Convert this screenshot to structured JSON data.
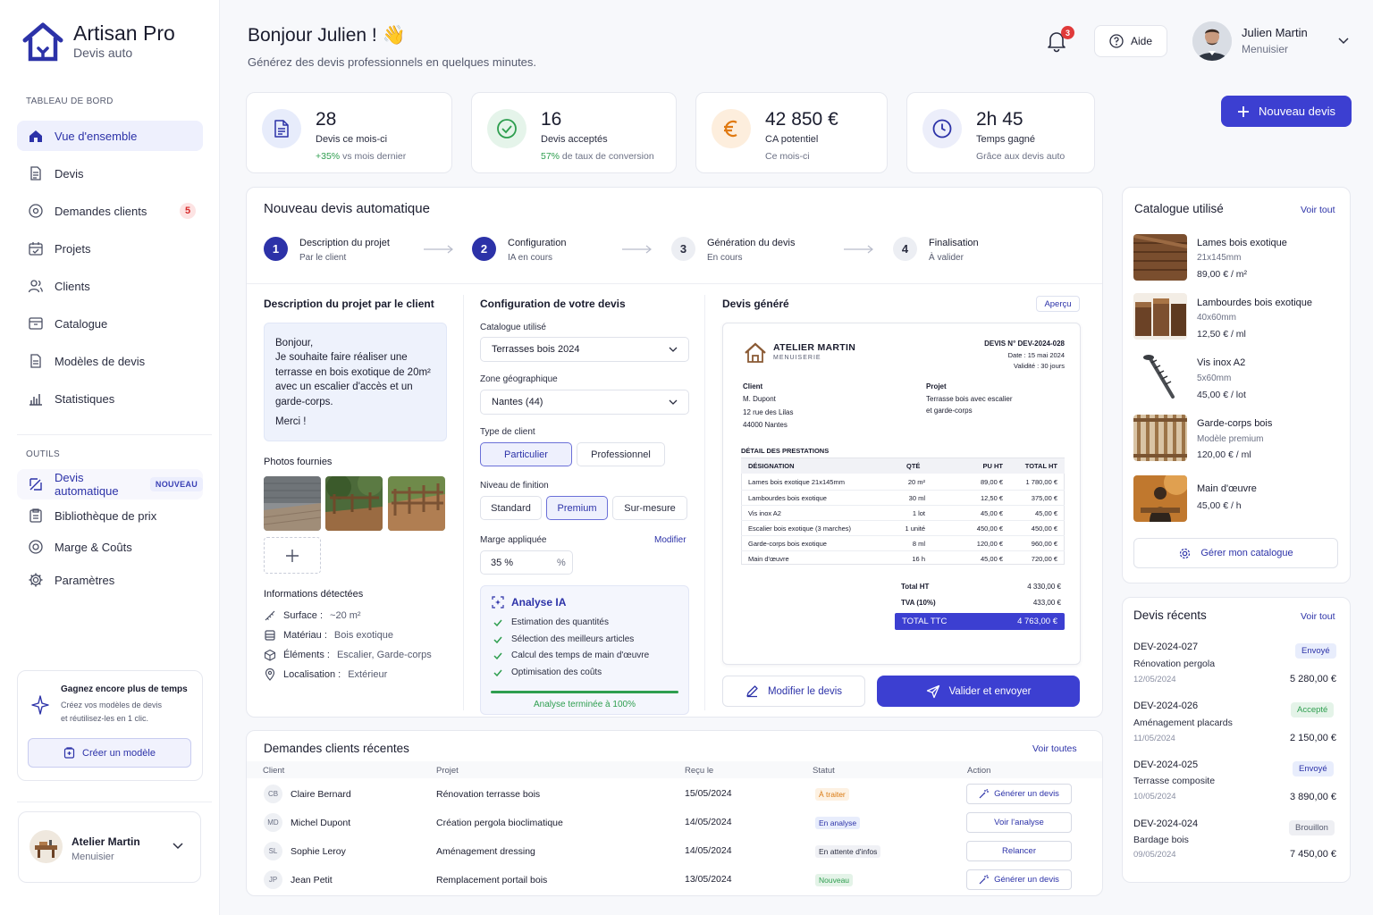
{
  "brand": {
    "title": "Artisan Pro",
    "subtitle": "Devis auto"
  },
  "sidebar": {
    "section_dashboard": "TABLEAU DE BORD",
    "items": [
      {
        "label": "Vue d'ensemble"
      },
      {
        "label": "Devis"
      },
      {
        "label": "Demandes clients",
        "badge": "5"
      },
      {
        "label": "Projets"
      },
      {
        "label": "Clients"
      },
      {
        "label": "Catalogue"
      },
      {
        "label": "Modèles de devis"
      },
      {
        "label": "Statistiques"
      }
    ],
    "section_tools": "OUTILS",
    "tools": [
      {
        "label": "Devis automatique",
        "badge": "NOUVEAU"
      },
      {
        "label": "Bibliothèque de prix"
      },
      {
        "label": "Marge & Coûts"
      },
      {
        "label": "Paramètres"
      }
    ],
    "tip": {
      "title": "Gagnez encore plus de temps",
      "text1": "Créez vos modèles de devis",
      "text2": "et réutilisez-les en 1 clic.",
      "button": "Créer un modèle"
    },
    "company": {
      "name": "Atelier Martin",
      "role": "Menuisier"
    }
  },
  "header": {
    "greeting": "Bonjour Julien ! 👋",
    "subtitle": "Générez des devis professionnels en quelques minutes.",
    "notifications": "3",
    "help": "Aide",
    "user": {
      "name": "Julien Martin",
      "role": "Menuisier"
    }
  },
  "stats": [
    {
      "value": "28",
      "label": "Devis ce mois-ci",
      "highlight": "+35%",
      "sub": " vs mois dernier"
    },
    {
      "value": "16",
      "label": "Devis acceptés",
      "highlight": "57%",
      "sub": " de taux de conversion"
    },
    {
      "value": "42 850 €",
      "label": "CA potentiel",
      "highlight": "",
      "sub": "Ce mois-ci"
    },
    {
      "value": "2h 45",
      "label": "Temps gagné",
      "highlight": "",
      "sub": "Grâce aux devis auto"
    }
  ],
  "new_quote_button": "Nouveau devis",
  "wizard": {
    "title": "Nouveau devis automatique",
    "steps": [
      {
        "n": "1",
        "title": "Description du projet",
        "sub": "Par le client"
      },
      {
        "n": "2",
        "title": "Configuration",
        "sub": "IA en cours"
      },
      {
        "n": "3",
        "title": "Génération du devis",
        "sub": "En cours"
      },
      {
        "n": "4",
        "title": "Finalisation",
        "sub": "À valider"
      }
    ],
    "description": {
      "title": "Description du projet par le client",
      "lines": [
        "Bonjour,",
        "Je souhaite faire réaliser une",
        "terrasse en bois exotique de 20m²",
        "avec un escalier d'accès et un",
        "garde-corps.",
        "Merci !"
      ],
      "photos_title": "Photos fournies",
      "info_title": "Informations détectées",
      "info": [
        {
          "k": "Surface :",
          "v": "~20 m²"
        },
        {
          "k": "Matériau :",
          "v": "Bois exotique"
        },
        {
          "k": "Éléments :",
          "v": "Escalier, Garde-corps"
        },
        {
          "k": "Localisation :",
          "v": "Extérieur"
        }
      ]
    },
    "config": {
      "title": "Configuration de votre devis",
      "catalogue_label": "Catalogue utilisé",
      "catalogue_value": "Terrasses bois 2024",
      "zone_label": "Zone géographique",
      "zone_value": "Nantes (44)",
      "client_label": "Type de client",
      "client_options": [
        "Particulier",
        "Professionnel"
      ],
      "finish_label": "Niveau de finition",
      "finish_options": [
        "Standard",
        "Premium",
        "Sur-mesure"
      ],
      "margin_label": "Marge appliquée",
      "margin_edit": "Modifier",
      "margin_value": "35 %",
      "margin_unit": "%",
      "ai": {
        "title": "Analyse IA",
        "items": [
          "Estimation des quantités",
          "Sélection des meilleurs articles",
          "Calcul des temps de main d'œuvre",
          "Optimisation des coûts"
        ],
        "progress": 100,
        "done": "Analyse terminée à 100%"
      }
    },
    "generated": {
      "title": "Devis généré",
      "preview": "Aperçu",
      "company": "ATELIER MARTIN",
      "company_sub": "MENUISERIE",
      "number": "DEVIS N° DEV-2024-028",
      "date": "Date : 15 mai 2024",
      "validity": "Validité : 30 jours",
      "client_label": "Client",
      "client_name": "M. Dupont",
      "client_addr1": "12 rue des Lilas",
      "client_addr2": "44000 Nantes",
      "project_label": "Projet",
      "project1": "Terrasse bois avec escalier",
      "project2": "et garde-corps",
      "detail_title": "DÉTAIL DES PRESTATIONS",
      "columns": [
        "DÉSIGNATION",
        "QTÉ",
        "PU HT",
        "TOTAL HT"
      ],
      "rows": [
        [
          "Lames bois exotique 21x145mm",
          "20 m²",
          "89,00 €",
          "1 780,00 €"
        ],
        [
          "Lambourdes bois exotique",
          "30 ml",
          "12,50 €",
          "375,00 €"
        ],
        [
          "Vis inox A2",
          "1 lot",
          "45,00 €",
          "45,00 €"
        ],
        [
          "Escalier bois exotique (3 marches)",
          "1 unité",
          "450,00 €",
          "450,00 €"
        ],
        [
          "Garde-corps bois exotique",
          "8 ml",
          "120,00 €",
          "960,00 €"
        ],
        [
          "Main d'œuvre",
          "16 h",
          "45,00 €",
          "720,00 €"
        ]
      ],
      "total_ht_label": "Total HT",
      "total_ht": "4 330,00 €",
      "tva_label": "TVA (10%)",
      "tva": "433,00 €",
      "ttc_label": "TOTAL TTC",
      "ttc": "4 763,00 €",
      "edit_button": "Modifier le devis",
      "send_button": "Valider et envoyer"
    }
  },
  "catalogue": {
    "title": "Catalogue utilisé",
    "see_all": "Voir tout",
    "items": [
      {
        "name": "Lames bois exotique",
        "size": "21x145mm",
        "price": "89,00 € / m²"
      },
      {
        "name": "Lambourdes bois exotique",
        "size": "40x60mm",
        "price": "12,50 € / ml"
      },
      {
        "name": "Vis inox A2",
        "size": "5x60mm",
        "price": "45,00 € / lot"
      },
      {
        "name": "Garde-corps bois",
        "size": "Modèle premium",
        "price": "120,00 € / ml"
      },
      {
        "name": "Main d'œuvre",
        "size": "",
        "price": "45,00 € / h"
      }
    ],
    "manage": "Gérer mon catalogue"
  },
  "recent_quotes": {
    "title": "Devis récents",
    "see_all": "Voir tout",
    "items": [
      {
        "id": "DEV-2024-027",
        "name": "Rénovation pergola",
        "date": "12/05/2024",
        "amount": "5 280,00 €",
        "status": "Envoyé"
      },
      {
        "id": "DEV-2024-026",
        "name": "Aménagement placards",
        "date": "11/05/2024",
        "amount": "2 150,00 €",
        "status": "Accepté"
      },
      {
        "id": "DEV-2024-025",
        "name": "Terrasse composite",
        "date": "10/05/2024",
        "amount": "3 890,00 €",
        "status": "Envoyé"
      },
      {
        "id": "DEV-2024-024",
        "name": "Bardage bois",
        "date": "09/05/2024",
        "amount": "7 450,00 €",
        "status": "Brouillon"
      }
    ]
  },
  "requests": {
    "title": "Demandes clients récentes",
    "see_all": "Voir toutes",
    "columns": [
      "Client",
      "Projet",
      "Reçu le",
      "Statut",
      "Action"
    ],
    "rows": [
      {
        "initials": "CB",
        "client": "Claire Bernard",
        "project": "Rénovation terrasse bois",
        "date": "15/05/2024",
        "status": "À traiter",
        "action": "Générer un devis"
      },
      {
        "initials": "MD",
        "client": "Michel Dupont",
        "project": "Création pergola bioclimatique",
        "date": "14/05/2024",
        "status": "En analyse",
        "action": "Voir l'analyse"
      },
      {
        "initials": "SL",
        "client": "Sophie Leroy",
        "project": "Aménagement dressing",
        "date": "14/05/2024",
        "status": "En attente d'infos",
        "action": "Relancer"
      },
      {
        "initials": "JP",
        "client": "Jean Petit",
        "project": "Remplacement portail bois",
        "date": "13/05/2024",
        "status": "Nouveau",
        "action": "Générer un devis"
      }
    ]
  },
  "colors": {
    "accent": "#3c3fd1",
    "success": "#2e9e4f",
    "warning": "#e07a12"
  }
}
